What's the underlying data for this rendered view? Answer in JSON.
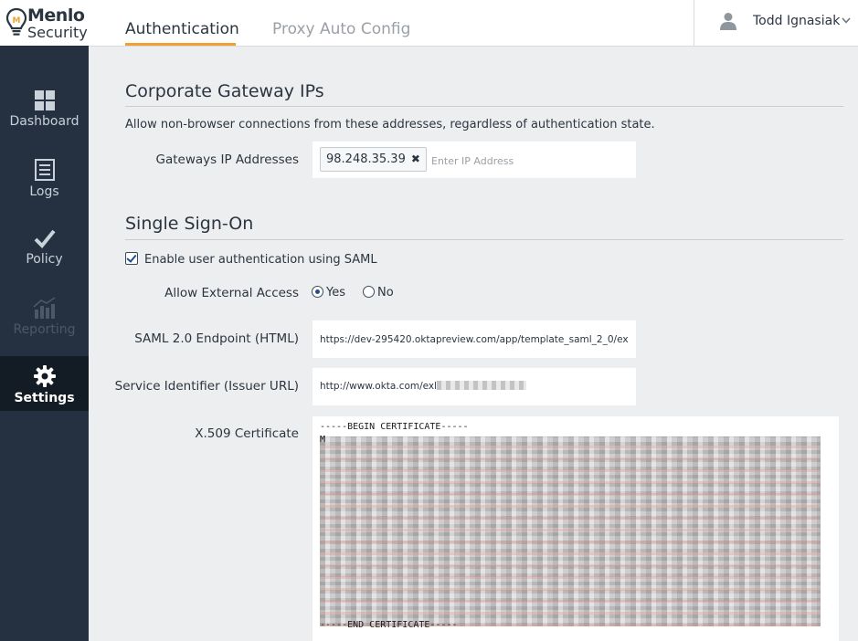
{
  "header": {
    "logo_line1": "Menlo",
    "logo_line2": "Security",
    "tabs": [
      {
        "label": "Authentication",
        "active": true
      },
      {
        "label": "Proxy Auto Config",
        "active": false
      }
    ],
    "user_name": "Todd Ignasiak"
  },
  "sidebar": {
    "items": [
      {
        "label": "Dashboard",
        "icon": "grid-icon",
        "state": "normal"
      },
      {
        "label": "Logs",
        "icon": "document-icon",
        "state": "normal"
      },
      {
        "label": "Policy",
        "icon": "checkmark-icon",
        "state": "normal"
      },
      {
        "label": "Reporting",
        "icon": "bar-chart-icon",
        "state": "disabled"
      },
      {
        "label": "Settings",
        "icon": "gear-icon",
        "state": "active"
      }
    ]
  },
  "gateway": {
    "title": "Corporate Gateway IPs",
    "description": "Allow non-browser connections from these addresses, regardless of authentication state.",
    "field_label": "Gateways IP Addresses",
    "ips": [
      "98.248.35.39"
    ],
    "input_placeholder": "Enter IP Address"
  },
  "sso": {
    "title": "Single Sign-On",
    "enable_label": "Enable user authentication using SAML",
    "enabled": true,
    "external_access_label": "Allow External Access",
    "external_access_options": [
      "Yes",
      "No"
    ],
    "external_access_selected": "Yes",
    "endpoint_label": "SAML 2.0 Endpoint (HTML)",
    "endpoint_value": "https://dev-295420.oktapreview.com/app/template_saml_2_0/ex",
    "issuer_label": "Service Identifier (Issuer URL)",
    "issuer_value_visible": "http://www.okta.com/exl",
    "cert_label": "X.509 Certificate",
    "cert_begin": "-----BEGIN CERTIFICATE-----",
    "cert_first_char": "M",
    "cert_end": "-----END CERTIFICATE-----"
  },
  "colors": {
    "sidebar_bg": "#253140",
    "sidebar_active_bg": "#131b24",
    "tab_accent": "#f0a030",
    "page_bg": "#edeef0"
  }
}
